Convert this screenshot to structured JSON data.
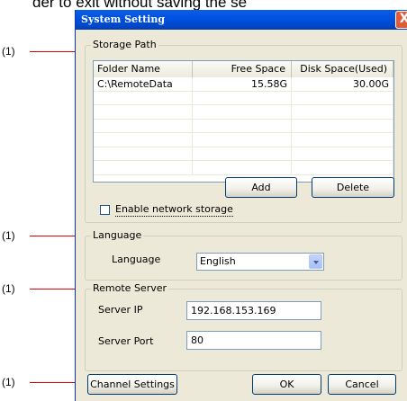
{
  "caption": {
    "text": "der to exit without saving the se"
  },
  "callouts": [
    "(1)",
    "(1)",
    "(1)",
    "(1)"
  ],
  "window": {
    "title": "System Setting",
    "close_glyph": "X"
  },
  "storage": {
    "group_label": "Storage Path",
    "columns": [
      "Folder Name",
      "Free Space",
      "Disk Space(Used)"
    ],
    "rows": [
      [
        "C:\\RemoteData",
        "15.58G",
        "30.00G"
      ],
      [
        "",
        "",
        ""
      ],
      [
        "",
        "",
        ""
      ],
      [
        "",
        "",
        ""
      ],
      [
        "",
        "",
        ""
      ],
      [
        "",
        "",
        ""
      ],
      [
        "",
        "",
        ""
      ]
    ],
    "add_label": "Add",
    "delete_label": "Delete",
    "network_label": "Enable network storage",
    "network_checked": false
  },
  "language": {
    "group_label": "Language",
    "field_label": "Language",
    "selected": "English"
  },
  "remote": {
    "group_label": "Remote Server",
    "ip_label": "Server IP",
    "ip_value": "192.168.153.169",
    "port_label": "Server Port",
    "port_value": "80"
  },
  "footer": {
    "channel_label": "Channel Settings",
    "ok_label": "OK",
    "cancel_label": "Cancel"
  },
  "colors": {
    "callout_line": "#dd0000",
    "titlebar": "#0052e0",
    "dialog_bg": "#ece9d8"
  }
}
